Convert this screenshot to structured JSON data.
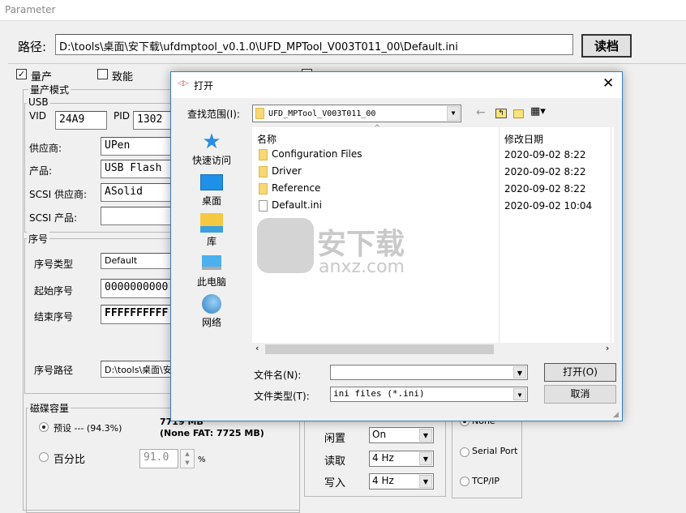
{
  "window": {
    "title": "Parameter"
  },
  "path": {
    "label": "路径:",
    "value": "D:\\tools\\桌面\\安下载\\ufdmptool_v0.1.0\\UFD_MPTool_V003T011_00\\Default.ini",
    "load_button": "读档"
  },
  "options": {
    "mass_production": "量产",
    "enable": "致能"
  },
  "mp_mode": {
    "title": "量产模式",
    "usb": {
      "title": "USB",
      "vid_label": "VID",
      "vid": "24A9",
      "pid_label": "PID",
      "pid": "1302"
    },
    "vendor_label": "供应商:",
    "vendor": "UPen",
    "product_label": "产品:",
    "product": "USB Flash",
    "scsi_vendor_label": "SCSI 供应商:",
    "scsi_vendor": "ASolid",
    "scsi_product_label": "SCSI 产品:",
    "scsi_product": ""
  },
  "serial": {
    "title": "序号",
    "type_label": "序号类型",
    "type": "Default",
    "start_label": "起始序号",
    "start": "0000000000",
    "end_label": "结束序号",
    "end": "FFFFFFFFFF",
    "path_label": "序号路径",
    "path": "D:\\tools\\桌面\\安"
  },
  "capacity": {
    "title": "磁碟容量",
    "preset_label": "预设 --- (94.3%)",
    "size": "7719 MB",
    "nonefat": "(None FAT: 7725 MB)",
    "percent_label": "百分比",
    "percent": "91.0",
    "unit": "%"
  },
  "led": {
    "idle_label": "闲置",
    "idle": "On",
    "read_label": "读取",
    "read": "4 Hz",
    "write_label": "写入",
    "write": "4 Hz"
  },
  "comm": {
    "none": "None",
    "serial": "Serial Port",
    "tcp": "TCP/IP"
  },
  "dialog": {
    "title": "打开",
    "lookin_label": "查找范围(I):",
    "lookin": "UFD_MPTool_V003T011_00",
    "nav": [
      {
        "label": "快速访问",
        "icon": "star-icon"
      },
      {
        "label": "桌面",
        "icon": "desktop-icon"
      },
      {
        "label": "库",
        "icon": "library-icon"
      },
      {
        "label": "此电脑",
        "icon": "computer-icon"
      },
      {
        "label": "网络",
        "icon": "network-icon"
      }
    ],
    "columns": {
      "name": "名称",
      "date": "修改日期"
    },
    "files": [
      {
        "name": "Configuration Files",
        "date": "2020-09-02 8:22",
        "type": "folder"
      },
      {
        "name": "Driver",
        "date": "2020-09-02 8:22",
        "type": "folder"
      },
      {
        "name": "Reference",
        "date": "2020-09-02 8:22",
        "type": "folder"
      },
      {
        "name": "Default.ini",
        "date": "2020-09-02 10:04",
        "type": "file"
      }
    ],
    "filename_label": "文件名(N):",
    "filename": "",
    "filetype_label": "文件类型(T):",
    "filetype": "ini files (*.ini)",
    "open_button": "打开(O)",
    "cancel_button": "取消"
  },
  "watermark": {
    "text": "安下载",
    "sub": "anxz.com"
  }
}
